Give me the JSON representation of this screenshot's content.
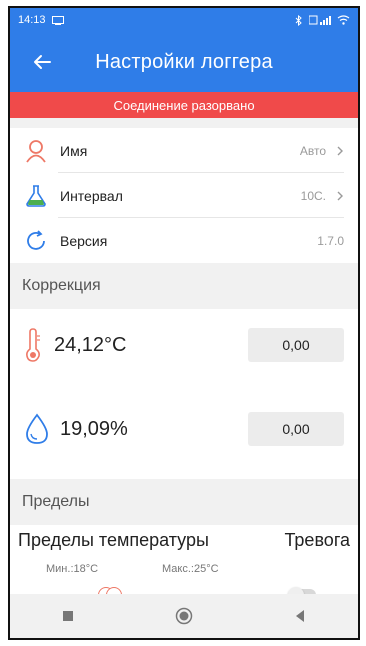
{
  "status_bar": {
    "time": "14:13"
  },
  "header": {
    "title": "Настройки логгера"
  },
  "banner": {
    "text": "Соединение разорвано"
  },
  "settings": [
    {
      "label": "Имя",
      "value": "Авто"
    },
    {
      "label": "Интервал",
      "value": "10С."
    },
    {
      "label": "Версия",
      "value": "1.7.0"
    }
  ],
  "correction": {
    "heading": "Коррекция",
    "temperature": {
      "reading": "24,12°С",
      "offset": "0,00"
    },
    "humidity": {
      "reading": "19,09%",
      "offset": "0,00"
    }
  },
  "limits": {
    "heading": "Пределы",
    "temp_label": "Пределы температуры",
    "alarm_label": "Тревога",
    "min_label": "Мин.:18°С",
    "max_label": "Макс.:25°С"
  },
  "colors": {
    "header_bg": "#2f7de8",
    "banner_bg": "#f04a4a",
    "accent_red": "#ee7866",
    "accent_blue": "#2f7de8",
    "accent_green": "#4caf50"
  },
  "icons": {
    "back": "arrow-left-icon",
    "name": "user-icon",
    "interval": "flask-icon",
    "version": "refresh-icon",
    "temperature": "thermometer-icon",
    "humidity": "water-drop-icon"
  }
}
